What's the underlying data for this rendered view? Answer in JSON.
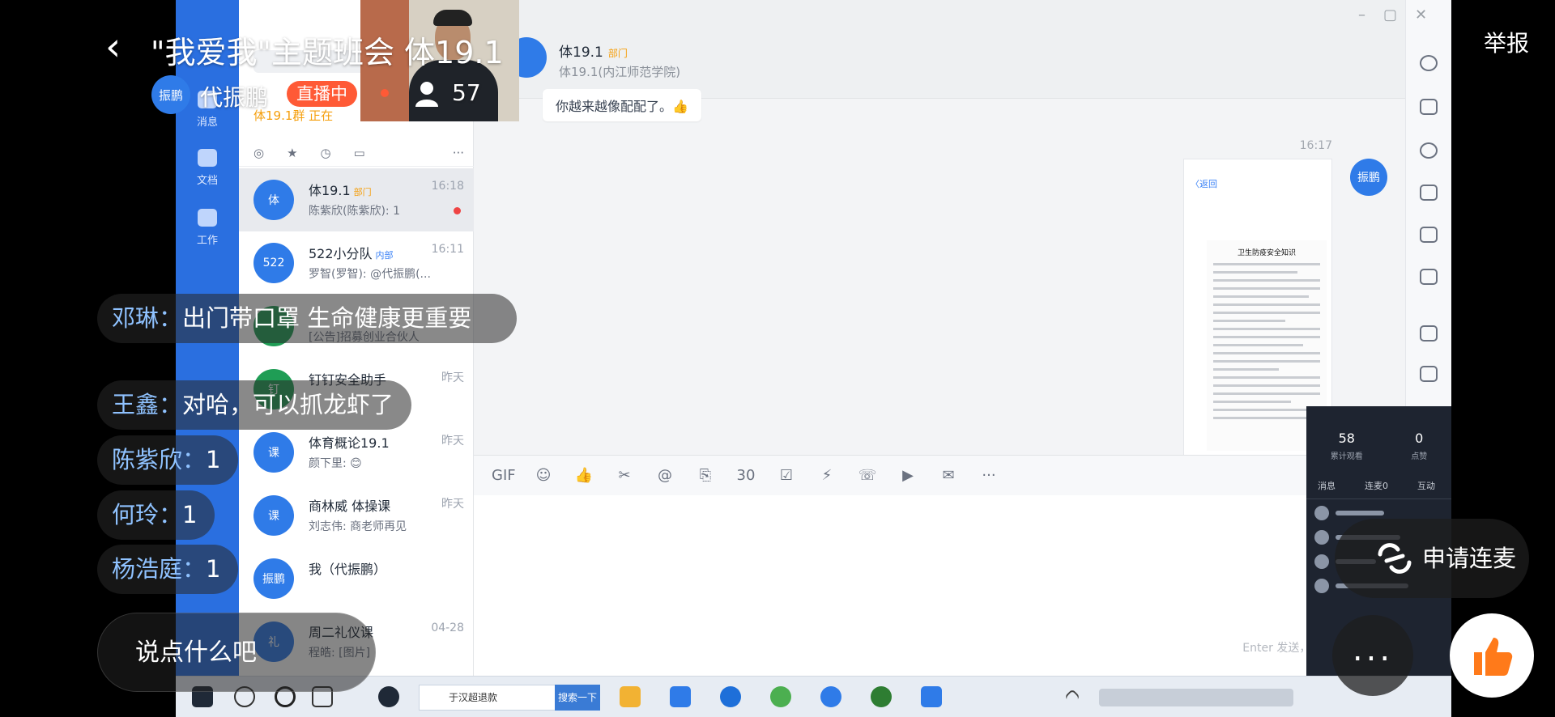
{
  "live": {
    "title": "\"我爱我\"主题班会 体19.1",
    "host_avatar": "振鹏",
    "host_name": "代振鹏",
    "status_badge": "直播中",
    "viewer_count": "57",
    "report": "举报"
  },
  "comments": [
    {
      "user": "邓琳",
      "sep": "：",
      "text": "出门带口罩 生命健康更重要"
    },
    {
      "user": "王鑫",
      "sep": "：",
      "text": "对哈，可以抓龙虾了"
    },
    {
      "user": "陈紫欣",
      "sep": "：",
      "text": "1"
    },
    {
      "user": "何玲",
      "sep": "：",
      "text": "1"
    },
    {
      "user": "杨浩庭",
      "sep": "：",
      "text": "1"
    }
  ],
  "input": {
    "placeholder": "说点什么吧"
  },
  "actions": {
    "apply_mic": "申请连麦",
    "more": "..."
  },
  "screen": {
    "rail": [
      "消息",
      "文档",
      "工作"
    ],
    "search_hint": "体19.1群 正在",
    "conversations": [
      {
        "avatar": "体",
        "name": "体19.1",
        "tag": "部门",
        "preview": "陈紫欣(陈紫欣): 1",
        "time": "16:18",
        "active": true
      },
      {
        "avatar": "522",
        "name": "522小分队",
        "tag": "内部",
        "preview": "罗智(罗智): @代振鹏(...",
        "time": "16:11"
      },
      {
        "avatar": "",
        "name": "",
        "tag": "",
        "preview": "[公告]招募创业合伙人",
        "time": ""
      },
      {
        "avatar": "钉",
        "name": "钉钉安全助手",
        "tag": "",
        "preview": "",
        "time": "昨天"
      },
      {
        "avatar": "课",
        "name": "体育概论19.1",
        "tag": "",
        "preview": "颜下里: 😊",
        "time": "昨天"
      },
      {
        "avatar": "课",
        "name": "商林威 体操课",
        "tag": "",
        "preview": "刘志伟: 商老师再见",
        "time": "昨天"
      },
      {
        "avatar": "振鹏",
        "name": "我（代振鹏）",
        "tag": "",
        "preview": "",
        "time": ""
      },
      {
        "avatar": "礼",
        "name": "周二礼仪课",
        "tag": "",
        "preview": "程皓: [图片]",
        "time": "04-28"
      }
    ],
    "chat": {
      "title": "体19.1",
      "tag": "部门",
      "subtitle": "体19.1(内江师范学院)",
      "message": "你越来越像配配了。👍",
      "time": "16:17",
      "me_avatar": "振鹏",
      "back_label": "〈返回",
      "doc_title": "卫生防疫安全知识",
      "input_hint": "Enter 发送，Ctrl+Enter 换行",
      "toolbar": [
        "GIF",
        "☺",
        "👍",
        "✂",
        "@",
        "⎘",
        "30",
        "☑",
        "⚡",
        "☏",
        "▶",
        "✉",
        "···"
      ]
    },
    "stats": {
      "viewers": "58",
      "viewers_label": "累计观看",
      "likes": "0",
      "likes_label": "点赞",
      "tab1": "消息",
      "tab2": "连麦0",
      "tab3": "互动"
    },
    "taskbar": {
      "search_text": "于汉超退款",
      "search_button": "搜索一下"
    }
  },
  "colors": {
    "live_badge": "#ff5a36",
    "accent": "#2f7be8",
    "comment_user": "#8fc2ff"
  }
}
